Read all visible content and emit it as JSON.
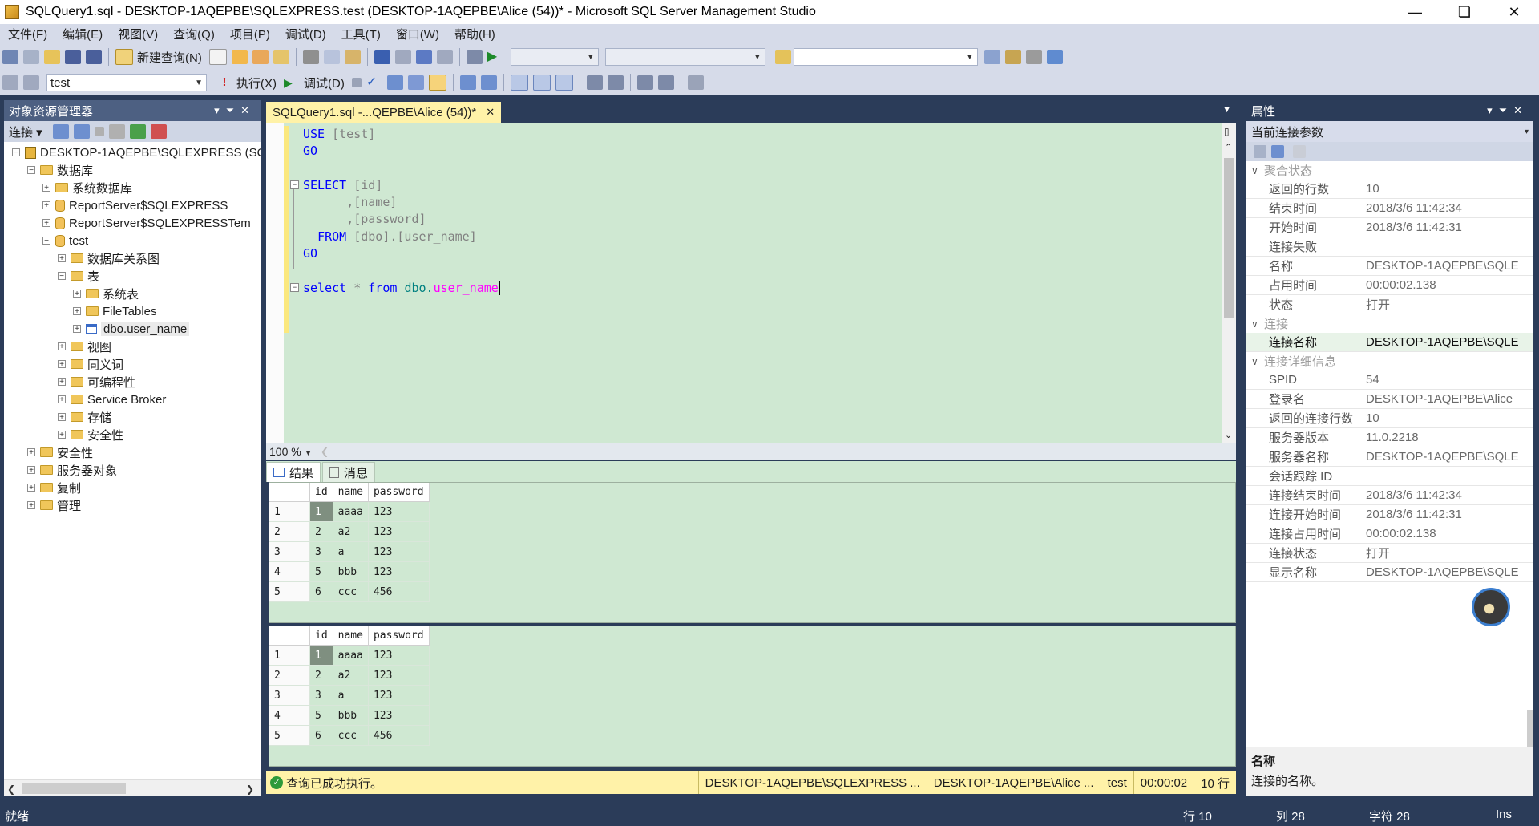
{
  "window": {
    "title": "SQLQuery1.sql - DESKTOP-1AQEPBE\\SQLEXPRESS.test (DESKTOP-1AQEPBE\\Alice (54))* - Microsoft SQL Server Management Studio"
  },
  "menu": [
    "文件(F)",
    "编辑(E)",
    "视图(V)",
    "查询(Q)",
    "项目(P)",
    "调试(D)",
    "工具(T)",
    "窗口(W)",
    "帮助(H)"
  ],
  "toolbar": {
    "new_query": "新建查询(N)",
    "database": "test",
    "execute": "执行(X)",
    "debug": "调试(D)"
  },
  "object_explorer": {
    "title": "对象资源管理器",
    "connect": "连接",
    "tree": [
      {
        "label": "DESKTOP-1AQEPBE\\SQLEXPRESS (SQ",
        "level": 0,
        "icon": "server",
        "exp": "−"
      },
      {
        "label": "数据库",
        "level": 1,
        "icon": "folder",
        "exp": "−"
      },
      {
        "label": "系统数据库",
        "level": 2,
        "icon": "folder",
        "exp": "+"
      },
      {
        "label": "ReportServer$SQLEXPRESS",
        "level": 2,
        "icon": "db",
        "exp": "+"
      },
      {
        "label": "ReportServer$SQLEXPRESSTem",
        "level": 2,
        "icon": "db",
        "exp": "+"
      },
      {
        "label": "test",
        "level": 2,
        "icon": "db",
        "exp": "−"
      },
      {
        "label": "数据库关系图",
        "level": 3,
        "icon": "folder",
        "exp": "+"
      },
      {
        "label": "表",
        "level": 3,
        "icon": "folder",
        "exp": "−"
      },
      {
        "label": "系统表",
        "level": 4,
        "icon": "folder",
        "exp": "+"
      },
      {
        "label": "FileTables",
        "level": 4,
        "icon": "folder",
        "exp": "+"
      },
      {
        "label": "dbo.user_name",
        "level": 4,
        "icon": "table",
        "exp": "+"
      },
      {
        "label": "视图",
        "level": 3,
        "icon": "folder",
        "exp": "+"
      },
      {
        "label": "同义词",
        "level": 3,
        "icon": "folder",
        "exp": "+"
      },
      {
        "label": "可编程性",
        "level": 3,
        "icon": "folder",
        "exp": "+"
      },
      {
        "label": "Service Broker",
        "level": 3,
        "icon": "folder",
        "exp": "+"
      },
      {
        "label": "存储",
        "level": 3,
        "icon": "folder",
        "exp": "+"
      },
      {
        "label": "安全性",
        "level": 3,
        "icon": "folder",
        "exp": "+"
      },
      {
        "label": "安全性",
        "level": 1,
        "icon": "folder",
        "exp": "+"
      },
      {
        "label": "服务器对象",
        "level": 1,
        "icon": "folder",
        "exp": "+"
      },
      {
        "label": "复制",
        "level": 1,
        "icon": "folder",
        "exp": "+"
      },
      {
        "label": "管理",
        "level": 1,
        "icon": "folder",
        "exp": "+"
      }
    ]
  },
  "editor": {
    "tab": "SQLQuery1.sql -...QEPBE\\Alice (54))*",
    "zoom": "100 %",
    "code": {
      "l1a": "USE",
      "l1b": "[test]",
      "l2": "GO",
      "l3a": "SELECT",
      "l3b": "[id]",
      "l4": ",[name]",
      "l5": ",[password]",
      "l6a": "FROM",
      "l6b": "[dbo].[user_name]",
      "l7": "GO",
      "l8a": "select",
      "l8b": "*",
      "l8c": "from",
      "l8d": "dbo.",
      "l8e": "user_name"
    }
  },
  "results": {
    "tab_results": "结果",
    "tab_messages": "消息",
    "columns": [
      "id",
      "name",
      "password"
    ],
    "rows": [
      [
        "1",
        "1",
        "aaaa",
        "123"
      ],
      [
        "2",
        "2",
        "a2",
        "123"
      ],
      [
        "3",
        "3",
        "a",
        "123"
      ],
      [
        "4",
        "5",
        "bbb",
        "123"
      ],
      [
        "5",
        "6",
        "ccc",
        "456"
      ]
    ]
  },
  "query_status": {
    "message": "查询已成功执行。",
    "server": "DESKTOP-1AQEPBE\\SQLEXPRESS ...",
    "user": "DESKTOP-1AQEPBE\\Alice ...",
    "db": "test",
    "time": "00:00:02",
    "rows": "10 行"
  },
  "properties": {
    "title": "属性",
    "combo": "当前连接参数",
    "cat1": "聚合状态",
    "cat1_rows": [
      [
        "返回的行数",
        "10"
      ],
      [
        "结束时间",
        "2018/3/6 11:42:34"
      ],
      [
        "开始时间",
        "2018/3/6 11:42:31"
      ],
      [
        "连接失败",
        ""
      ],
      [
        "名称",
        "DESKTOP-1AQEPBE\\SQLE"
      ],
      [
        "占用时间",
        "00:00:02.138"
      ],
      [
        "状态",
        "打开"
      ]
    ],
    "cat2": "连接",
    "cat2_rows": [
      [
        "连接名称",
        "DESKTOP-1AQEPBE\\SQLE"
      ]
    ],
    "cat3": "连接详细信息",
    "cat3_rows": [
      [
        "SPID",
        "54"
      ],
      [
        "登录名",
        "DESKTOP-1AQEPBE\\Alice"
      ],
      [
        "返回的连接行数",
        "10"
      ],
      [
        "服务器版本",
        "11.0.2218"
      ],
      [
        "服务器名称",
        "DESKTOP-1AQEPBE\\SQLE"
      ],
      [
        "会话跟踪 ID",
        ""
      ],
      [
        "连接结束时间",
        "2018/3/6 11:42:34"
      ],
      [
        "连接开始时间",
        "2018/3/6 11:42:31"
      ],
      [
        "连接占用时间",
        "00:00:02.138"
      ],
      [
        "连接状态",
        "打开"
      ],
      [
        "显示名称",
        "DESKTOP-1AQEPBE\\SQLE"
      ]
    ],
    "desc_title": "名称",
    "desc_text": "连接的名称。"
  },
  "statusbar": {
    "ready": "就绪",
    "line": "行 10",
    "col": "列 28",
    "ch": "字符 28",
    "ins": "Ins"
  },
  "colors": {
    "chrome": "#2b3c59",
    "toolbar": "#d6dbe9",
    "editor_bg": "#cfe8d2",
    "tab_active": "#fff2a8"
  }
}
